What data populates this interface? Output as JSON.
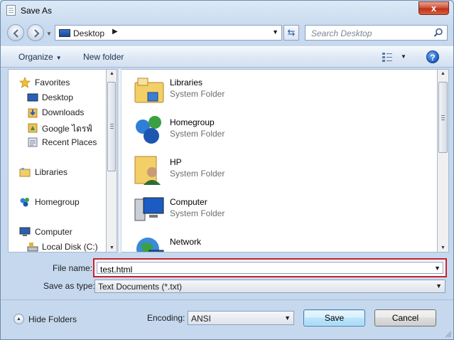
{
  "window": {
    "title": "Save As",
    "close_label": "x"
  },
  "address": {
    "crumb": "Desktop",
    "search_placeholder": "Search Desktop"
  },
  "toolbar": {
    "organize_label": "Organize",
    "new_folder_label": "New folder",
    "help_label": "?"
  },
  "nav_pane": {
    "items": [
      {
        "label": "Favorites",
        "icon": "star-icon"
      },
      {
        "label": "Desktop",
        "icon": "desktop-icon"
      },
      {
        "label": "Downloads",
        "icon": "downloads-icon"
      },
      {
        "label": "Google ไดรฟ์",
        "icon": "google-drive-icon"
      },
      {
        "label": "Recent Places",
        "icon": "recent-places-icon"
      },
      {
        "label": "Libraries",
        "icon": "libraries-icon"
      },
      {
        "label": "Homegroup",
        "icon": "homegroup-icon"
      },
      {
        "label": "Computer",
        "icon": "computer-icon"
      },
      {
        "label": "Local Disk (C:)",
        "icon": "local-disk-icon"
      }
    ]
  },
  "file_pane": {
    "items": [
      {
        "name": "Libraries",
        "type": "System Folder",
        "icon": "libraries-icon"
      },
      {
        "name": "Homegroup",
        "type": "System Folder",
        "icon": "homegroup-icon"
      },
      {
        "name": "HP",
        "type": "System Folder",
        "icon": "user-folder-icon"
      },
      {
        "name": "Computer",
        "type": "System Folder",
        "icon": "computer-icon"
      },
      {
        "name": "Network",
        "type": "",
        "icon": "network-icon"
      }
    ]
  },
  "form": {
    "file_name_label": "File name:",
    "file_name_value": "test.html",
    "save_type_label": "Save as type:",
    "save_type_value": "Text Documents (*.txt)",
    "encoding_label": "Encoding:",
    "encoding_value": "ANSI"
  },
  "footer": {
    "hide_folders_label": "Hide Folders",
    "save_label": "Save",
    "cancel_label": "Cancel"
  },
  "colors": {
    "highlight_border": "#c8202f",
    "title_bar": "#c9dbee",
    "close_button": "#c0311a"
  }
}
